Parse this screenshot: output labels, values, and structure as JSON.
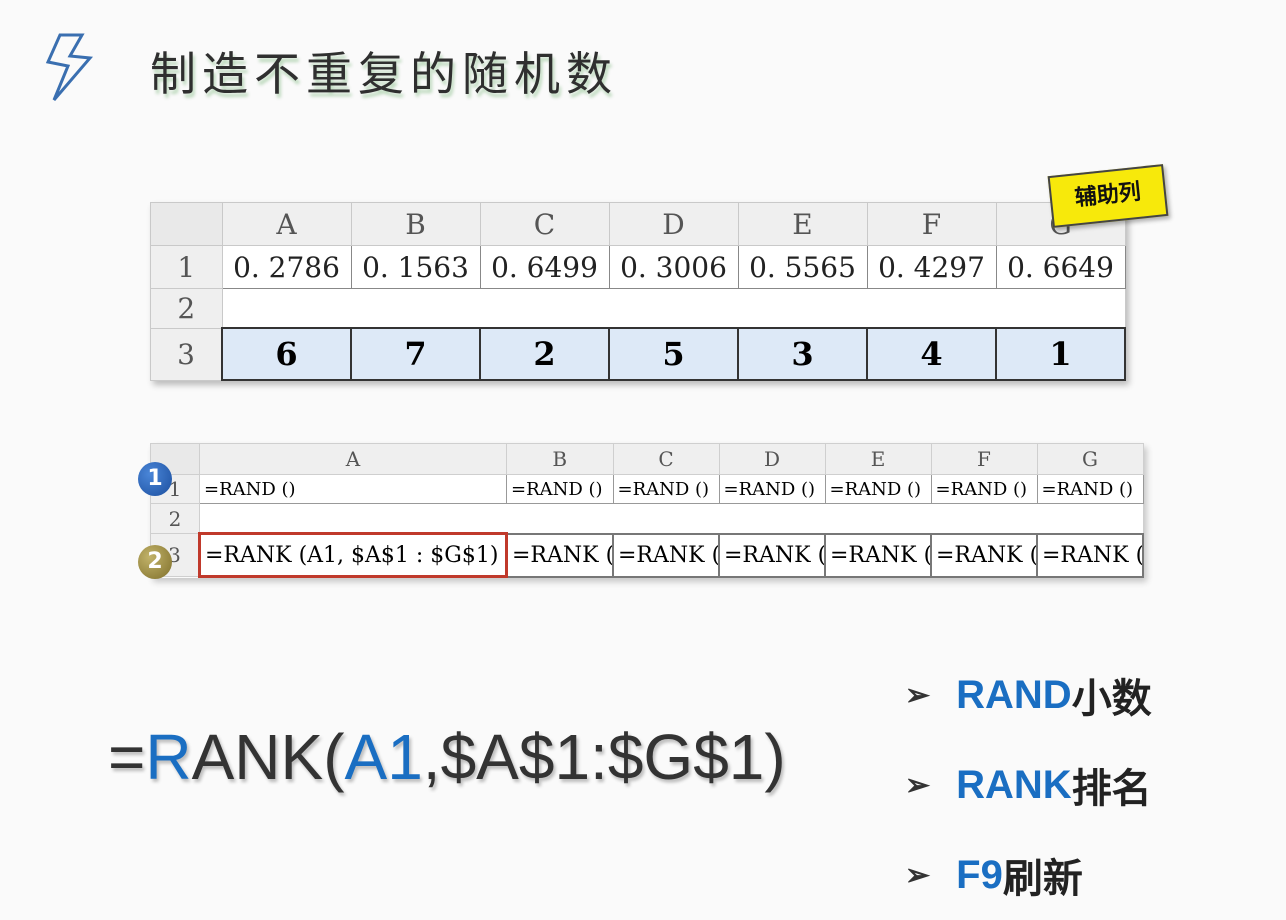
{
  "title": "制造不重复的随机数",
  "icons": {
    "title_icon": "lightning-bolt-icon",
    "bullet_icon": "arrow-right-icon"
  },
  "table1": {
    "columns": [
      "A",
      "B",
      "C",
      "D",
      "E",
      "F",
      "G"
    ],
    "row_labels": [
      "1",
      "2",
      "3"
    ],
    "row1": [
      "0. 2786",
      "0. 1563",
      "0. 6499",
      "0. 3006",
      "0. 5565",
      "0. 4297",
      "0. 6649"
    ],
    "row3": [
      "6",
      "7",
      "2",
      "5",
      "3",
      "4",
      "1"
    ]
  },
  "sticky_note": "辅助列",
  "table2": {
    "columns": [
      "A",
      "B",
      "C",
      "D",
      "E",
      "F",
      "G"
    ],
    "row_labels": [
      "1",
      "2",
      "3"
    ],
    "row1": [
      "=RAND ()",
      "=RAND ()",
      "=RAND ()",
      "=RAND ()",
      "=RAND ()",
      "=RAND ()",
      "=RAND ()"
    ],
    "row3": [
      "=RANK (A1, $A$1 : $G$1)",
      "=RANK (I",
      "=RANK ((",
      "=RANK (I",
      "=RANK (I",
      "=RANK (I",
      "=RANK (("
    ],
    "badges": [
      "1",
      "2"
    ]
  },
  "formula": {
    "eq": "=",
    "r": "R",
    "ank": "ANK(",
    "a1": "A1",
    "rest": ",$A$1:$G$1)"
  },
  "bullets": [
    {
      "kw": "RAND",
      "text": "小数"
    },
    {
      "kw": "RANK",
      "text": "排名"
    },
    {
      "kw": "F9",
      "text": "刷新"
    }
  ],
  "colors": {
    "accent": "#1a6ec2",
    "highlight_row": "#dde9f7",
    "sticky": "#f7e90b",
    "selection": "#c0392b"
  }
}
